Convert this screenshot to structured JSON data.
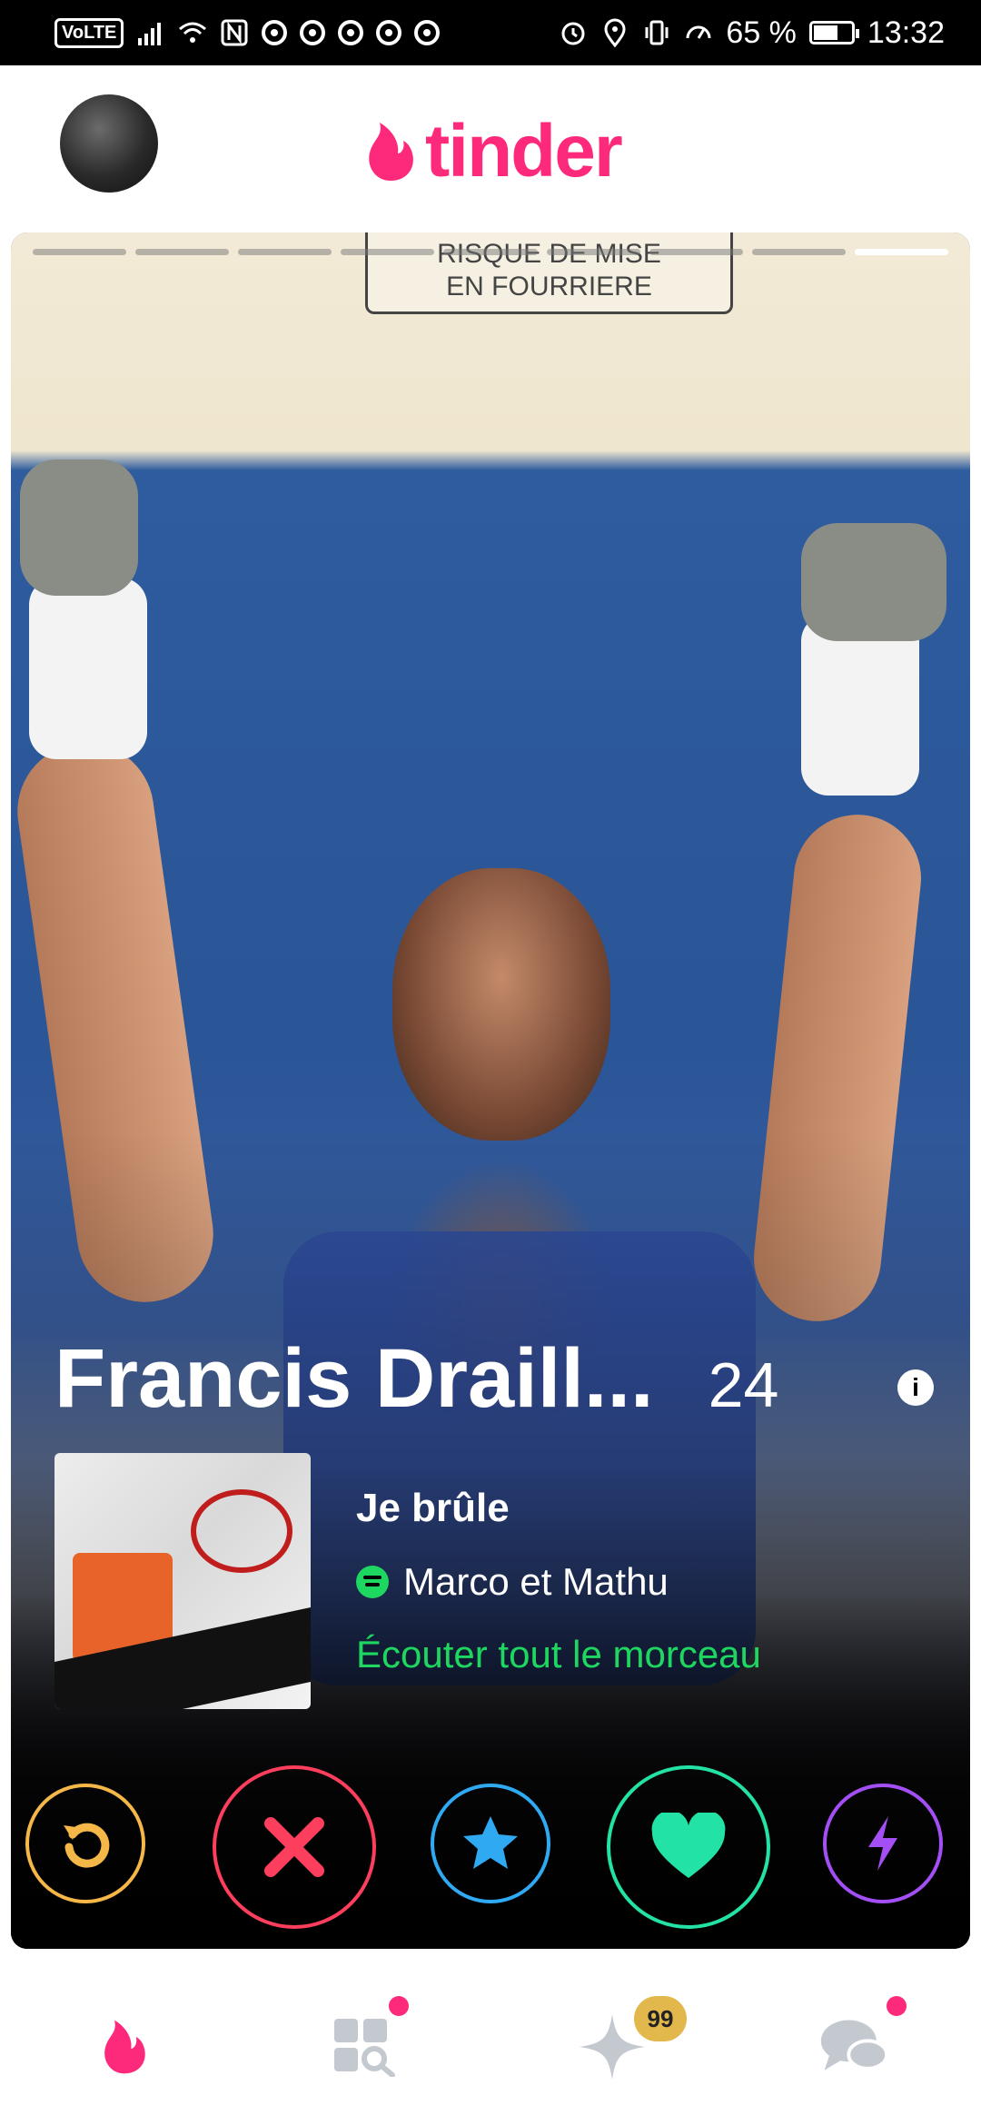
{
  "status_bar": {
    "volte": "VoLTE",
    "battery_percent": "65 %",
    "battery_level": 0.65,
    "time": "13:32"
  },
  "header": {
    "logo_text": "tinder",
    "brand_color": "#fd297b"
  },
  "card": {
    "photo_count": 9,
    "active_photo_index": 8,
    "sign_line1": "RISQUE DE MISE",
    "sign_line2": "EN FOURRIERE",
    "name": "Francis Draill...",
    "age": "24",
    "info_icon": "i",
    "anthem": {
      "title": "Je brûle",
      "artist": "Marco et Mathu",
      "listen_label": "Écouter tout le morceau"
    }
  },
  "actions": [
    {
      "name": "rewind",
      "color": "#f5b748"
    },
    {
      "name": "nope",
      "color": "#fd3e5c"
    },
    {
      "name": "super-like",
      "color": "#2fa9f2"
    },
    {
      "name": "like",
      "color": "#22e3a5"
    },
    {
      "name": "boost",
      "color": "#a34ff5"
    }
  ],
  "bottom_nav": {
    "tabs": [
      "home",
      "explore",
      "likes",
      "messages"
    ],
    "likes_badge": "99"
  }
}
